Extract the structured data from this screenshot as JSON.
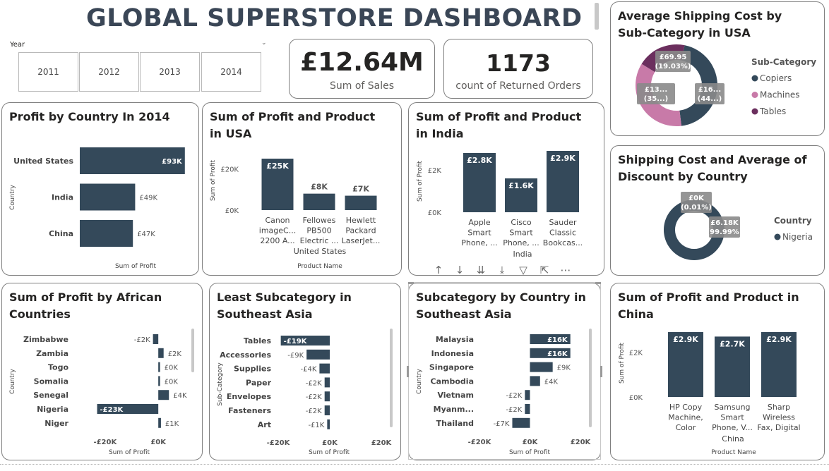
{
  "header": {
    "title": "GLOBAL SUPERSTORE DASHBOARD"
  },
  "slicer": {
    "title": "Year",
    "years": [
      "2011",
      "2012",
      "2013",
      "2014"
    ]
  },
  "kpis": [
    {
      "value": "£12.64M",
      "label": "Sum of Sales"
    },
    {
      "value": "1173",
      "label": "count of Returned Orders"
    }
  ],
  "toolbar_icons": [
    "arrow-up-icon",
    "arrow-down-icon",
    "double-arrow-down-icon",
    "expand-down-icon",
    "filter-icon",
    "focus-mode-icon",
    "more-options-icon"
  ],
  "colors": {
    "primary": "#34495a",
    "pink": "#c87aa8",
    "purple": "#6b2f5e"
  },
  "chart_data": [
    {
      "id": "profit_country_2014",
      "type": "bar",
      "orientation": "horizontal",
      "title": "Profit by Country In 2014",
      "categories": [
        "United States",
        "India",
        "China"
      ],
      "values": [
        93,
        49,
        47
      ],
      "labels": [
        "£93K",
        "£49K",
        "£47K"
      ],
      "xlabel": "Sum of Profit",
      "ylabel": "Country",
      "xlim": [
        0,
        100
      ]
    },
    {
      "id": "profit_product_usa",
      "type": "bar",
      "title": "Sum of Profit and Product in USA",
      "categories": [
        [
          "Canon",
          "imageC...",
          "2200 A..."
        ],
        [
          "Fellowes",
          "PB500",
          "Electric ..."
        ],
        [
          "Hewlett",
          "Packard",
          "LaserJet..."
        ]
      ],
      "group_label": "United States",
      "values": [
        25,
        8,
        7
      ],
      "labels": [
        "£25K",
        "£8K",
        "£7K"
      ],
      "yticks": [
        "£20K",
        "£0K"
      ],
      "xlabel": "Product Name",
      "ylabel": "Sum of Profit",
      "ylim": [
        0,
        27
      ]
    },
    {
      "id": "profit_product_india",
      "type": "bar",
      "title": "Sum of Profit and Product in India",
      "categories": [
        [
          "Apple",
          "Smart",
          "Phone, ..."
        ],
        [
          "Cisco",
          "Smart",
          "Phone, ..."
        ],
        [
          "Sauder",
          "Classic",
          "Bookcas..."
        ]
      ],
      "group_label": "India",
      "values": [
        2.8,
        1.6,
        2.9
      ],
      "labels": [
        "£2.8K",
        "£1.6K",
        "£2.9K"
      ],
      "yticks": [
        "£2K",
        "£0K"
      ],
      "xlabel": "Product Name",
      "ylabel": "Sum of Profit",
      "ylim": [
        0,
        3.1
      ]
    },
    {
      "id": "avg_ship_subcat_usa",
      "type": "pie",
      "donut": true,
      "title": "Average Shipping Cost by Sub-Category in USA",
      "legend_title": "Sub-Category",
      "slices": [
        {
          "name": "Copiers",
          "share": 44.0,
          "label": [
            "£16...",
            "(44...)"
          ],
          "color": "#34495a"
        },
        {
          "name": "Machines",
          "share": 35.0,
          "label": [
            "£13...",
            "(35...)"
          ],
          "color": "#c87aa8"
        },
        {
          "name": "Tables",
          "share": 19.03,
          "label": [
            "£69.95",
            "(19.03%)"
          ],
          "color": "#6b2f5e"
        }
      ]
    },
    {
      "id": "ship_discount_country",
      "type": "pie",
      "donut": true,
      "title": "Shipping Cost and Average of Discount by Country",
      "legend_title": "Country",
      "slices": [
        {
          "name": "Nigeria",
          "share": 99.99,
          "label": [
            "£6.18K",
            "(99.99%)"
          ],
          "color": "#34495a"
        },
        {
          "name": "",
          "share": 0.01,
          "label": [
            "£0K",
            "(0.01%)"
          ],
          "color": "#34495a"
        }
      ],
      "legend": [
        "Nigeria"
      ]
    },
    {
      "id": "profit_african",
      "type": "bar",
      "orientation": "horizontal",
      "title": "Sum of Profit by African Countries",
      "categories": [
        "Zimbabwe",
        "Zambia",
        "Togo",
        "Somalia",
        "Senegal",
        "Nigeria",
        "Niger"
      ],
      "values": [
        -2,
        2,
        0,
        0,
        4,
        -23,
        1
      ],
      "labels": [
        "-£2K",
        "£2K",
        "£0K",
        "£0K",
        "£4K",
        "-£23K",
        "£1K"
      ],
      "xticks": [
        "-£20K",
        "£0K"
      ],
      "xlabel": "Sum of Profit",
      "ylabel": "Country",
      "xlim": [
        -25,
        5
      ]
    },
    {
      "id": "least_subcat_sea",
      "type": "bar",
      "orientation": "horizontal",
      "title": "Least Subcategory in Southeast Asia",
      "categories": [
        "Tables",
        "Accessories",
        "Supplies",
        "Paper",
        "Envelopes",
        "Fasteners",
        "Art"
      ],
      "values": [
        -19,
        -9,
        -4,
        -2,
        -2,
        -2,
        -1
      ],
      "labels": [
        "-£19K",
        "-£9K",
        "-£4K",
        "-£2K",
        "-£2K",
        "-£2K",
        "-£1K"
      ],
      "xticks": [
        "-£20K",
        "£0K",
        "£20K"
      ],
      "xlabel": "Sum of Profit",
      "ylabel": "Sub-Category",
      "xlim": [
        -20,
        20
      ]
    },
    {
      "id": "subcat_country_sea",
      "type": "bar",
      "orientation": "horizontal",
      "title": "Subcategory by Country in Southeast Asia",
      "categories": [
        "Malaysia",
        "Indonesia",
        "Singapore",
        "Cambodia",
        "Vietnam",
        "Myanm...",
        "Thailand"
      ],
      "values": [
        16,
        16,
        9,
        4,
        -2,
        -2,
        -7
      ],
      "labels": [
        "£16K",
        "£16K",
        "£9K",
        "£4K",
        "-£2K",
        "-£2K",
        "-£7K"
      ],
      "xticks": [
        "-£20K",
        "£0K",
        "£20K"
      ],
      "xlabel": "Sum of Profit",
      "ylabel": "Country",
      "xlim": [
        -20,
        20
      ]
    },
    {
      "id": "profit_product_china",
      "type": "bar",
      "title": "Sum of Profit and Product in China",
      "categories": [
        [
          "HP Copy",
          "Machine,",
          "Color"
        ],
        [
          "Samsung",
          "Smart",
          "Phone, V..."
        ],
        [
          "Sharp",
          "Wireless",
          "Fax, Digital"
        ]
      ],
      "group_label": "China",
      "values": [
        2.9,
        2.7,
        2.9
      ],
      "labels": [
        "£2.9K",
        "£2.7K",
        "£2.9K"
      ],
      "yticks": [
        "£2K",
        "£0K"
      ],
      "xlabel": "Product Name",
      "ylabel": "Sum of Profit",
      "ylim": [
        0,
        3.1
      ]
    }
  ]
}
